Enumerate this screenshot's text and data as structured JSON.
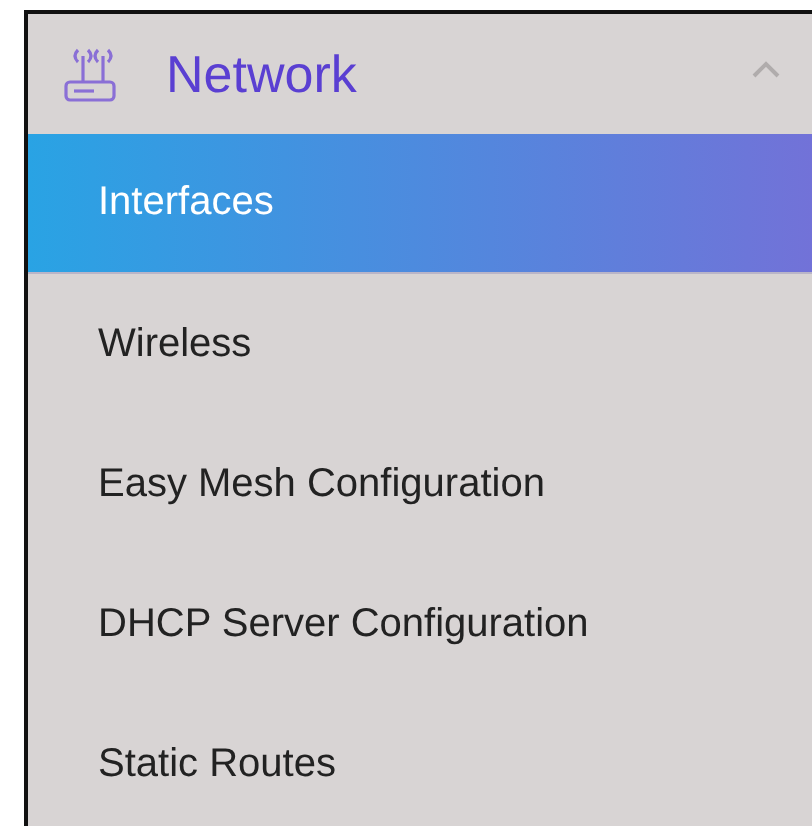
{
  "menu": {
    "title": "Network",
    "expanded": true,
    "items": [
      {
        "label": "Interfaces",
        "selected": true
      },
      {
        "label": "Wireless",
        "selected": false
      },
      {
        "label": "Easy Mesh Configuration",
        "selected": false
      },
      {
        "label": "DHCP Server Configuration",
        "selected": false
      },
      {
        "label": "Static Routes",
        "selected": false
      }
    ]
  }
}
